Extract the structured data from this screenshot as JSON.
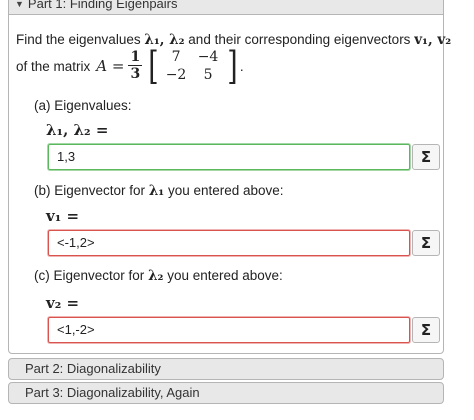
{
  "part1": {
    "title": "Part 1: Finding Eigenpairs",
    "prompt_pre": "Find the eigenvalues",
    "prompt_lambdas": "λ₁, λ₂",
    "prompt_mid": "and their corresponding eigenvectors",
    "prompt_vectors": "v₁, v₂",
    "prompt_of": "of the matrix",
    "matrix_name": "A =",
    "frac_num": "1",
    "frac_den": "3",
    "matrix": [
      "7",
      "−4",
      "−2",
      "5"
    ],
    "period": ".",
    "a_label": "(a) Eigenvalues:",
    "a_math": "λ₁, λ₂ =",
    "a_value": "1,3",
    "b_label_pre": "(b) Eigenvector for",
    "b_label_lambda": "λ₁",
    "b_label_post": "you entered above:",
    "b_math": "v₁ =",
    "b_value": "<-1,2>",
    "c_label_pre": "(c) Eigenvector for",
    "c_label_lambda": "λ₂",
    "c_label_post": "you entered above:",
    "c_math": "v₂ =",
    "c_value": "<1,-2>",
    "sigma_label": "Σ"
  },
  "part2": {
    "title": "Part 2: Diagonalizability"
  },
  "part3": {
    "title": "Part 3: Diagonalizability, Again"
  }
}
